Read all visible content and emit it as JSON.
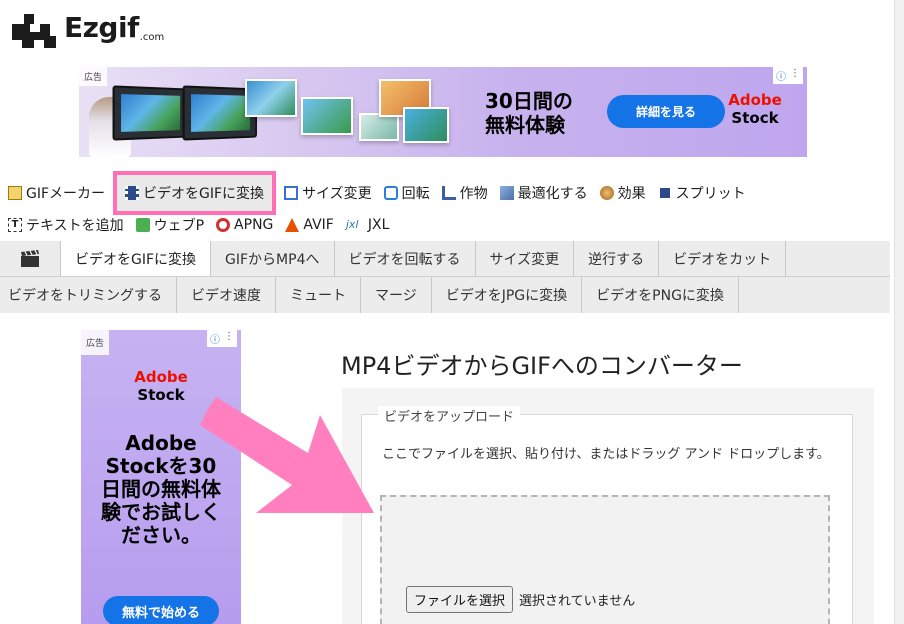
{
  "logo": {
    "text": "Ezgif",
    "suffix": ".com"
  },
  "ad_top": {
    "tag": "広告",
    "headline_line1": "30日間の",
    "headline_line2": "無料体験",
    "cta": "詳細を見る",
    "brand_line1": "Adobe",
    "brand_line2": "Stock",
    "info_icon": "ⓘ",
    "menu_icon": "⋮"
  },
  "tools": {
    "row1": [
      {
        "label": "GIFメーカー",
        "icon": "gif-maker-icon",
        "color": "#d4a017"
      },
      {
        "label": "ビデオをGIFに変換",
        "icon": "film-icon",
        "color": "#2a4a8a",
        "active": true
      },
      {
        "label": "サイズ変更",
        "icon": "resize-icon",
        "color": "#3a6fd8"
      },
      {
        "label": "回転",
        "icon": "rotate-icon",
        "color": "#2a7fd8"
      },
      {
        "label": "作物",
        "icon": "crop-icon",
        "color": "#3a5fa8"
      },
      {
        "label": "最適化する",
        "icon": "optimize-icon",
        "color": "#4a6fa8"
      },
      {
        "label": "効果",
        "icon": "effects-icon",
        "color": "#c08030"
      },
      {
        "label": "スプリット",
        "icon": "split-icon",
        "color": "#2a4a8a"
      }
    ],
    "row2": [
      {
        "label": "テキストを追加",
        "icon": "text-icon",
        "color": "#333333"
      },
      {
        "label": "ウェブP",
        "icon": "webp-icon",
        "color": "#4caf50"
      },
      {
        "label": "APNG",
        "icon": "apng-icon",
        "color": "#d32f2f"
      },
      {
        "label": "AVIF",
        "icon": "avif-icon",
        "color": "#e65100"
      },
      {
        "label": "JXL",
        "icon": "jxl-icon",
        "color": "#2e7d9a"
      }
    ]
  },
  "subtabs": {
    "row1": [
      "ビデオをGIFに変換",
      "GIFからMP4へ",
      "ビデオを回転する",
      "サイズ変更",
      "逆行する",
      "ビデオをカット"
    ],
    "row2": [
      "ビデオをトリミングする",
      "ビデオ速度",
      "ミュート",
      "マージ",
      "ビデオをJPGに変換",
      "ビデオをPNGに変換"
    ]
  },
  "ad_side": {
    "tag": "広告",
    "brand_line1": "Adobe",
    "brand_line2": "Stock",
    "copy": "Adobe Stockを30日間の無料体験でお試しください。",
    "cta": "無料で始める"
  },
  "main": {
    "title": "MP4ビデオからGIFへのコンバーター",
    "legend": "ビデオをアップロード",
    "instructions": "ここでファイルを選択、貼り付け、またはドラッグ アンド ドロップします。",
    "file_button": "ファイルを選択",
    "file_status": "選択されていません"
  },
  "colors": {
    "highlight": "#ff6fb5",
    "arrow": "#ff7fbf",
    "cta_blue": "#1473e6",
    "adobe_red": "#eb1000"
  }
}
